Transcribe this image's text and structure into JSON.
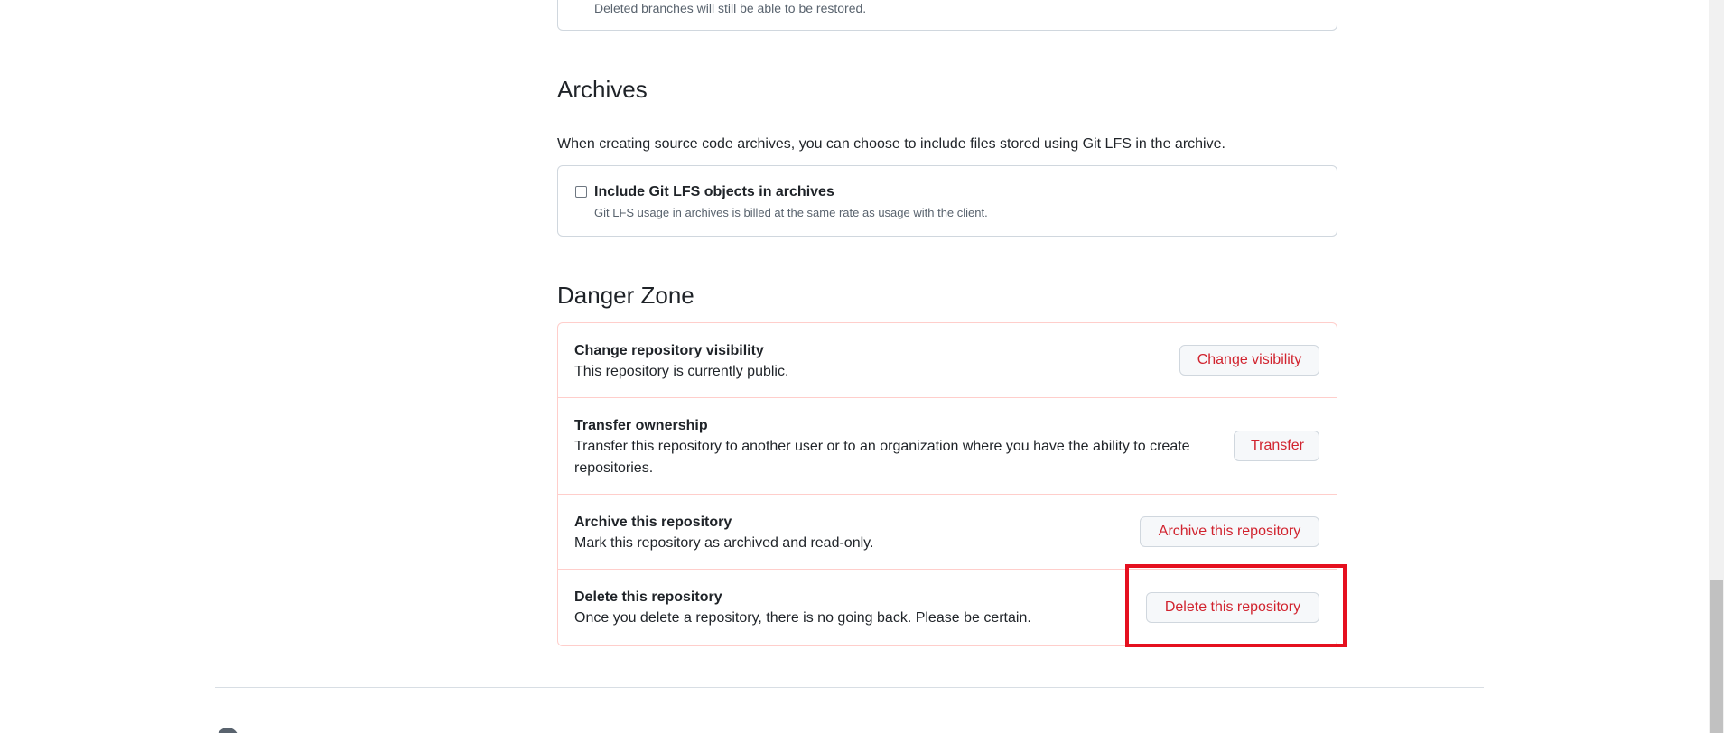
{
  "top_box": {
    "note": "Deleted branches will still be able to be restored."
  },
  "archives": {
    "title": "Archives",
    "description": "When creating source code archives, you can choose to include files stored using Git LFS in the archive.",
    "checkbox_label": "Include Git LFS objects in archives",
    "checkbox_note": "Git LFS usage in archives is billed at the same rate as usage with the client.",
    "checkbox_checked": false
  },
  "danger_zone": {
    "title": "Danger Zone",
    "rows": [
      {
        "title": "Change repository visibility",
        "description": "This repository is currently public.",
        "button": "Change visibility"
      },
      {
        "title": "Transfer ownership",
        "description_line1": "Transfer this repository to another user or to an organization where you have the ability to create",
        "description_line2": "repositories.",
        "button": "Transfer"
      },
      {
        "title": "Archive this repository",
        "description": "Mark this repository as archived and read-only.",
        "button": "Archive this repository"
      },
      {
        "title": "Delete this repository",
        "description": "Once you delete a repository, there is no going back. Please be certain.",
        "button": "Delete this repository"
      }
    ]
  },
  "colors": {
    "danger_text": "#d1242f",
    "danger_border": "#ffcecb",
    "highlight": "#e5101f"
  }
}
